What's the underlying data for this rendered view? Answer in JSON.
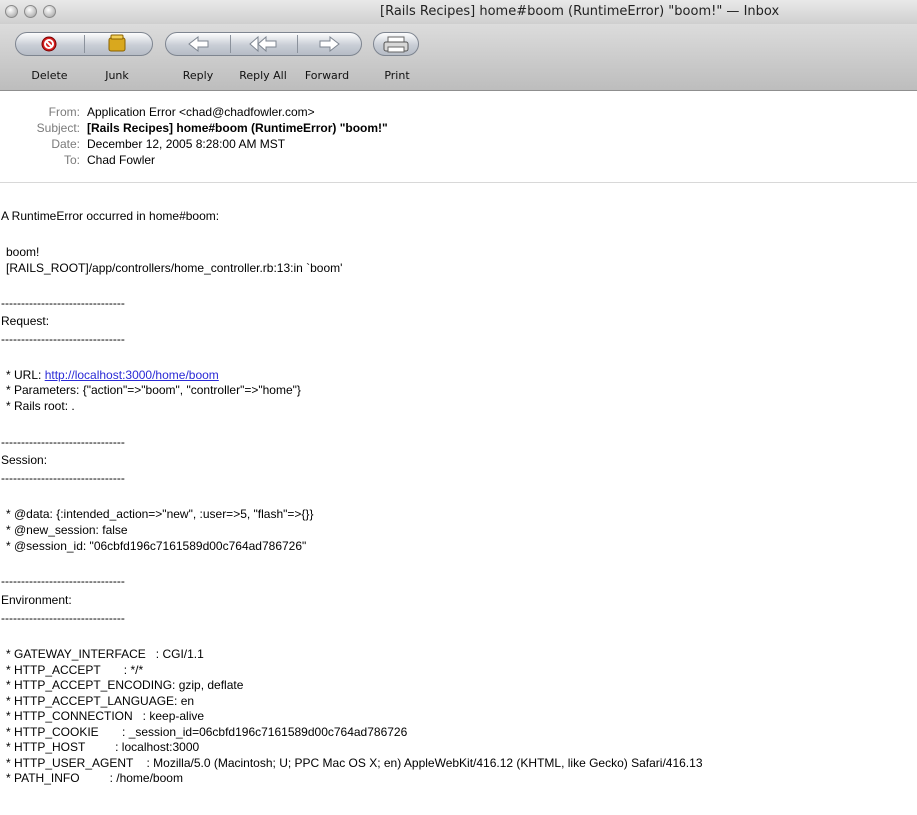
{
  "window": {
    "title": "[Rails Recipes] home#boom (RuntimeError) \"boom!\" — Inbox"
  },
  "toolbar": {
    "delete_label": "Delete",
    "junk_label": "Junk",
    "reply_label": "Reply",
    "reply_all_label": "Reply All",
    "forward_label": "Forward",
    "print_label": "Print"
  },
  "headers": {
    "from_key": "From:",
    "from_value": "Application Error <chad@chadfowler.com>",
    "subject_key": "Subject:",
    "subject_value": "[Rails Recipes] home#boom (RuntimeError) \"boom!\"",
    "date_key": "Date:",
    "date_value": "December 12, 2005 8:28:00 AM MST",
    "to_key": "To:",
    "to_value": "Chad Fowler"
  },
  "message": {
    "intro": "A RuntimeError occurred in home#boom:",
    "error_message": "boom!",
    "backtrace": "[RAILS_ROOT]/app/controllers/home_controller.rb:13:in `boom'",
    "divider": "-------------------------------",
    "request_heading": "Request:",
    "url_label": "* URL: ",
    "url_link": "http://localhost:3000/home/boom",
    "parameters": "* Parameters: {\"action\"=>\"boom\", \"controller\"=>\"home\"}",
    "rails_root": "* Rails root: .",
    "session_heading": "Session:",
    "session_data": "* @data: {:intended_action=>\"new\", :user=>5, \"flash\"=>{}}",
    "session_new": "* @new_session: false",
    "session_id": "* @session_id: \"06cbfd196c7161589d00c764ad786726\"",
    "environment_heading": "Environment:",
    "env": [
      "* GATEWAY_INTERFACE   : CGI/1.1",
      "* HTTP_ACCEPT       : */*",
      "* HTTP_ACCEPT_ENCODING: gzip, deflate",
      "* HTTP_ACCEPT_LANGUAGE: en",
      "* HTTP_CONNECTION   : keep-alive",
      "* HTTP_COOKIE       : _session_id=06cbfd196c7161589d00c764ad786726",
      "* HTTP_HOST         : localhost:3000",
      "* HTTP_USER_AGENT    : Mozilla/5.0 (Macintosh; U; PPC Mac OS X; en) AppleWebKit/416.12 (KHTML, like Gecko) Safari/416.13",
      "* PATH_INFO         : /home/boom"
    ]
  }
}
